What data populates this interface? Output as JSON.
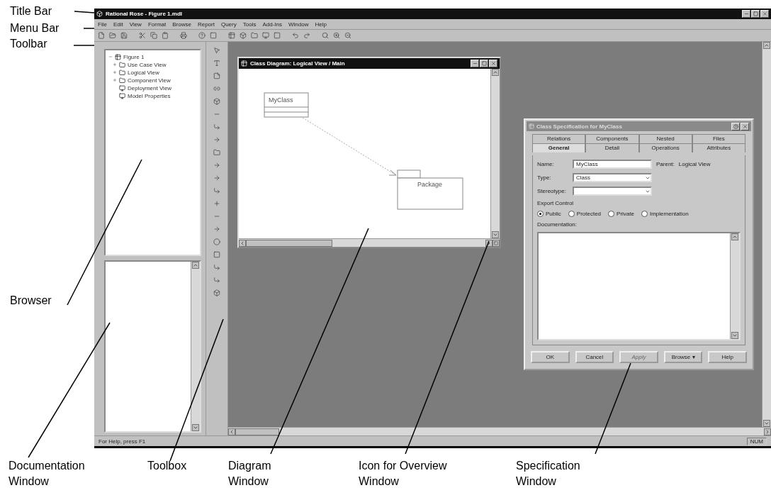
{
  "side_labels": [
    "Title Bar",
    "Menu Bar",
    "Toolbar",
    "Browser"
  ],
  "bottom_labels": [
    "Documentation Window",
    "Toolbox",
    "Diagram Window",
    "Icon for Overview Window",
    "Specification Window"
  ],
  "window": {
    "title": "Rational Rose - Figure 1.mdl"
  },
  "menu": [
    "File",
    "Edit",
    "View",
    "Format",
    "Browse",
    "Report",
    "Query",
    "Tools",
    "Add-Ins",
    "Window",
    "Help"
  ],
  "browser": {
    "root": {
      "label": "Figure 1",
      "expanded": true,
      "children": [
        {
          "label": "Use Case View",
          "kind": "folder"
        },
        {
          "label": "Logical View",
          "kind": "folder"
        },
        {
          "label": "Component View",
          "kind": "folder"
        },
        {
          "label": "Deployment View",
          "kind": "leaf"
        },
        {
          "label": "Model Properties",
          "kind": "leaf"
        }
      ]
    }
  },
  "diagram_window": {
    "title": "Class Diagram: Logical View / Main",
    "class_name": "MyClass",
    "package_name": "Package"
  },
  "spec_window": {
    "title": "Class Specification for MyClass",
    "tabs": [
      [
        {
          "label": "Relations",
          "selected": false
        },
        {
          "label": "Components",
          "selected": false
        },
        {
          "label": "Nested",
          "selected": false
        },
        {
          "label": "Files",
          "selected": false
        }
      ],
      [
        {
          "label": "General",
          "selected": true
        },
        {
          "label": "Detail",
          "selected": false
        },
        {
          "label": "Operations",
          "selected": false
        },
        {
          "label": "Attributes",
          "selected": false
        }
      ]
    ],
    "name_label": "Name:",
    "name_value": "MyClass",
    "parent_label": "Parent:",
    "parent_value": "Logical View",
    "type_label": "Type:",
    "type_value": "Class",
    "stereotype_label": "Stereotype:",
    "export_label": "Export Control",
    "export_options": [
      {
        "label": "Public",
        "selected": true
      },
      {
        "label": "Protected",
        "selected": false
      },
      {
        "label": "Private",
        "selected": false
      },
      {
        "label": "Implementation",
        "selected": false
      }
    ],
    "documentation_label": "Documentation:",
    "buttons": [
      {
        "label": "OK",
        "disabled": false
      },
      {
        "label": "Cancel",
        "disabled": false
      },
      {
        "label": "Apply",
        "disabled": true
      },
      {
        "label": "Browse ▾",
        "disabled": false
      },
      {
        "label": "Help",
        "disabled": false
      }
    ]
  },
  "status_bar": {
    "help": "For Help, press F1",
    "num": "NUM"
  }
}
